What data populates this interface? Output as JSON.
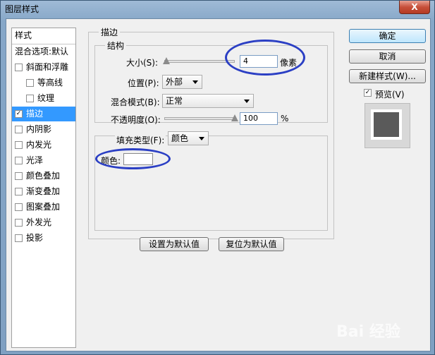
{
  "window": {
    "title": "图层样式",
    "close_label": "X"
  },
  "left_list": {
    "items": [
      {
        "label": "样式",
        "checkbox": false,
        "selected": false
      },
      {
        "label": "混合选项:默认",
        "checkbox": false,
        "selected": false
      },
      {
        "label": "斜面和浮雕",
        "checkbox": true,
        "checked": false,
        "indent": false
      },
      {
        "label": "等高线",
        "checkbox": true,
        "checked": false,
        "indent": true
      },
      {
        "label": "纹理",
        "checkbox": true,
        "checked": false,
        "indent": true
      },
      {
        "label": "描边",
        "checkbox": true,
        "checked": true,
        "selected": true
      },
      {
        "label": "内阴影",
        "checkbox": true,
        "checked": false
      },
      {
        "label": "内发光",
        "checkbox": true,
        "checked": false
      },
      {
        "label": "光泽",
        "checkbox": true,
        "checked": false
      },
      {
        "label": "颜色叠加",
        "checkbox": true,
        "checked": false
      },
      {
        "label": "渐变叠加",
        "checkbox": true,
        "checked": false
      },
      {
        "label": "图案叠加",
        "checkbox": true,
        "checked": false
      },
      {
        "label": "外发光",
        "checkbox": true,
        "checked": false
      },
      {
        "label": "投影",
        "checkbox": true,
        "checked": false
      }
    ]
  },
  "stroke": {
    "group_title": "描边",
    "structure_title": "结构",
    "size": {
      "label": "大小(S):",
      "value": "4",
      "unit": "像素",
      "slider_fraction": 0.03
    },
    "position": {
      "label": "位置(P):",
      "value": "外部"
    },
    "blend_mode": {
      "label": "混合模式(B):",
      "value": "正常"
    },
    "opacity": {
      "label": "不透明度(O):",
      "value": "100",
      "unit": "%",
      "slider_fraction": 1.0
    },
    "fill_type": {
      "label": "填充类型(F):",
      "value": "颜色"
    },
    "color": {
      "label": "颜色:",
      "swatch": "#ffffff"
    },
    "buttons": {
      "make_default": "设置为默认值",
      "reset_default": "复位为默认值"
    }
  },
  "right_panel": {
    "ok": "确定",
    "cancel": "取消",
    "new_style": "新建样式(W)...",
    "preview_label": "预览(V)",
    "preview_checked": true
  },
  "watermark": {
    "text": "Bai 经验"
  }
}
